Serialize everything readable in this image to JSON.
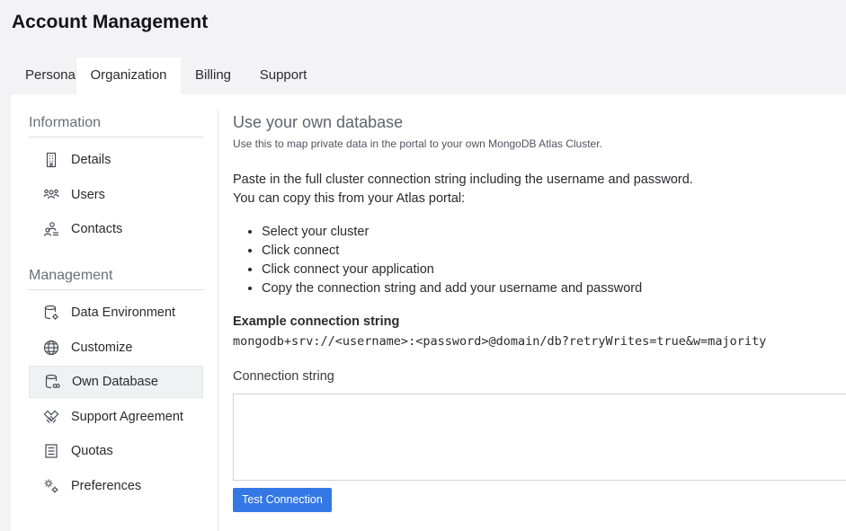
{
  "page": {
    "title": "Account Management"
  },
  "tabs": [
    {
      "label": "Personal"
    },
    {
      "label": "Organization"
    },
    {
      "label": "Billing"
    },
    {
      "label": "Support"
    }
  ],
  "active_tab": "Organization",
  "sidebar": {
    "information": {
      "title": "Information",
      "items": [
        {
          "label": "Details",
          "icon": "building-icon"
        },
        {
          "label": "Users",
          "icon": "users-icon"
        },
        {
          "label": "Contacts",
          "icon": "contacts-icon"
        }
      ]
    },
    "management": {
      "title": "Management",
      "items": [
        {
          "label": "Data Environment",
          "icon": "database-gear-icon"
        },
        {
          "label": "Customize",
          "icon": "globe-icon"
        },
        {
          "label": "Own Database",
          "icon": "database-link-icon"
        },
        {
          "label": "Support Agreement",
          "icon": "handshake-icon"
        },
        {
          "label": "Quotas",
          "icon": "list-icon"
        },
        {
          "label": "Preferences",
          "icon": "gears-icon"
        }
      ]
    },
    "active_item": "Own Database"
  },
  "main": {
    "heading": "Use your own database",
    "subtitle": "Use this to map private data in the portal to your own MongoDB Atlas Cluster.",
    "instruction_line1": "Paste in the full cluster connection string including the username and password.",
    "instruction_line2": "You can copy this from your Atlas portal:",
    "steps": [
      "Select your cluster",
      "Click connect",
      "Click connect your application",
      "Copy the connection string and add your username and password"
    ],
    "example_label": "Example connection string",
    "example_value": "mongodb+srv://<username>:<password>@domain/db?retryWrites=true&w=majority",
    "connection_label": "Connection string",
    "connection_value": "",
    "connection_placeholder": "",
    "test_button": "Test Connection"
  },
  "colors": {
    "accent": "#3478e6",
    "page_bg": "#f3f3f5",
    "panel_bg": "#ffffff"
  }
}
